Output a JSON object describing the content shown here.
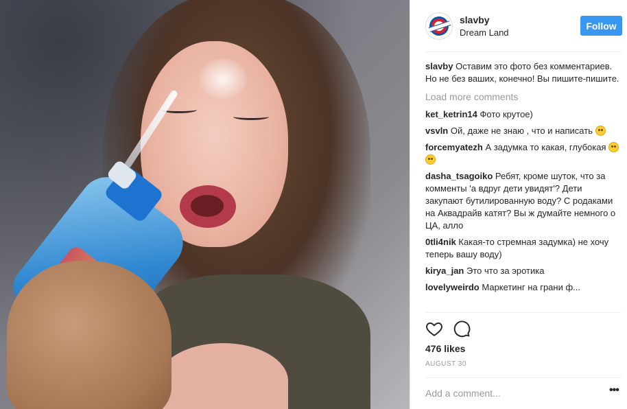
{
  "post": {
    "image_alt": "Post photo",
    "header": {
      "username": "slavby",
      "location": "Dream Land",
      "follow_label": "Follow"
    },
    "caption": {
      "author": "slavby",
      "text": "Оставим это фото без комментариев. Но не без ваших, конечно! Вы пишите-пишите."
    },
    "load_more_label": "Load more comments",
    "comments": [
      {
        "author": "ket_ketrin14",
        "text": "Фото крутое)",
        "emoji_count": 0
      },
      {
        "author": "vsvln",
        "text": "Ой, даже не знаю , что и написать",
        "emoji_count": 1
      },
      {
        "author": "forcemyatezh",
        "text": "А задумка то какая, глубокая",
        "emoji_count": 2
      },
      {
        "author": "dasha_tsagoiko",
        "text": "Ребят, кроме шуток, что за комменты 'а вдруг дети увидят'? Дети закупают бутилированную воду? С родаками на Аквадрайв катят? Вы ж думайте немного о ЦА, алло",
        "emoji_count": 0
      },
      {
        "author": "0tli4nik",
        "text": "Какая-то стремная задумка) не хочу теперь вашу воду)",
        "emoji_count": 0
      },
      {
        "author": "kirya_jan",
        "text": "Это что за эротика",
        "emoji_count": 0
      },
      {
        "author": "lovelyweirdo",
        "text": "Маркетинг на грани ф...",
        "emoji_count": 0
      }
    ],
    "likes": "476 likes",
    "date": "AUGUST 30",
    "add_comment_placeholder": "Add a comment...",
    "more_label": "•••",
    "icons": {
      "like": "heart-icon",
      "comment": "comment-bubble-icon",
      "more": "more-options-icon"
    },
    "colors": {
      "follow_button": "#3897f0",
      "muted_text": "#999999",
      "divider": "#efefef"
    }
  }
}
